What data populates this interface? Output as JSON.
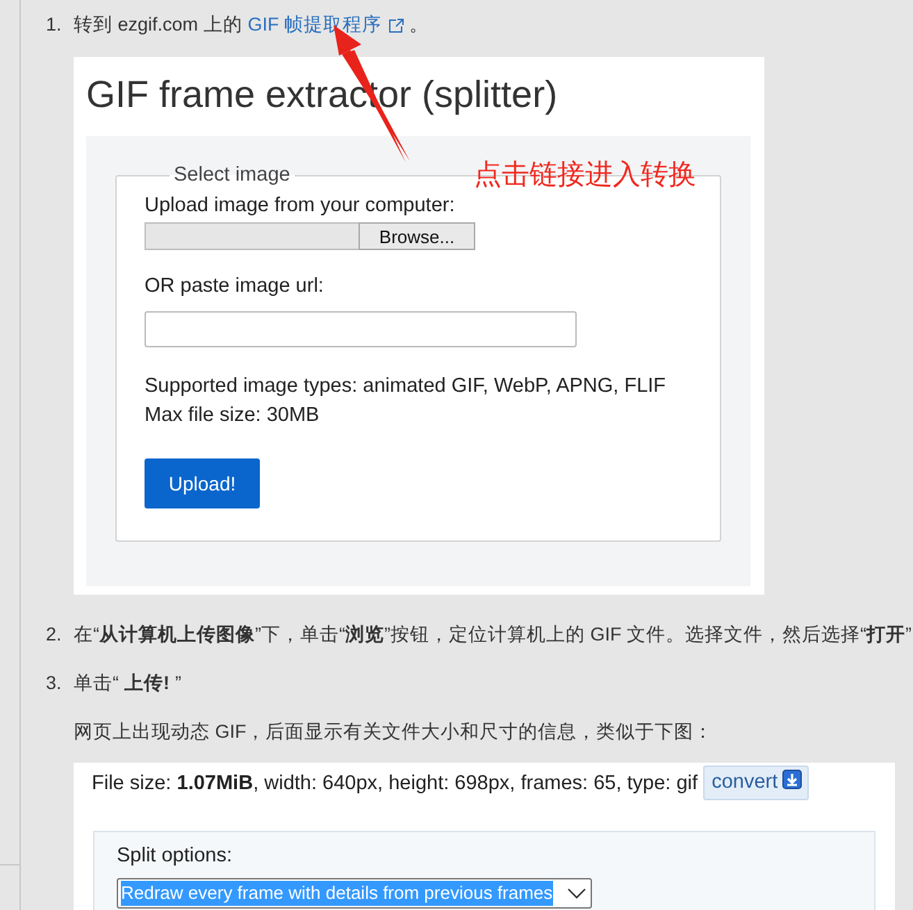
{
  "step_1": {
    "number": "1.",
    "text_before": "转到 ezgif.com 上的",
    "link": "GIF 帧提取程序",
    "text_after": "。"
  },
  "screenshot_1": {
    "title": "GIF frame extractor (splitter)",
    "legend": "Select image",
    "upload_label": "Upload image from your computer:",
    "browse_button": "Browse...",
    "url_label": "OR paste image url:",
    "supported_text": "Supported image types: animated GIF, WebP, APNG, FLIF",
    "max_size_text": "Max file size: 30MB",
    "upload_button": "Upload!"
  },
  "annotation": {
    "text": "点击链接进入转换"
  },
  "step_2": {
    "number": "2.",
    "text": "在“**从计算机上传图像**”下，单击“**浏览**”按钮，定位计算机上的 GIF 文件。选择文件，然后选择“**打开**”"
  },
  "step_3": {
    "number": "3.",
    "text": "单击“**上传!**”"
  },
  "note": "网页上出现动态 GIF，后面显示有关文件大小和尺寸的信息，类似于下图：",
  "screenshot_2": {
    "file_info": "File size: **1.07MiB**, width: 640px, height: 698px, frames: 65, type: gif",
    "convert_button": "convert",
    "split_label": "Split options:",
    "split_select": {
      "value": "Redraw every frame with details from previous frames"
    }
  }
}
